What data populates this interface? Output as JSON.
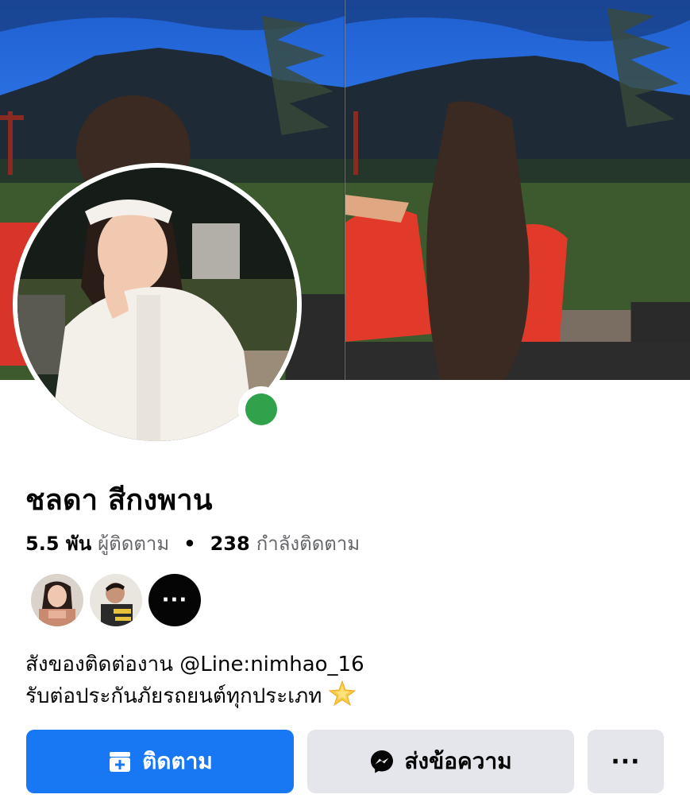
{
  "profile": {
    "name": "ชลดา สีกงพาน",
    "online": true
  },
  "stats": {
    "followers_count": "5.5 พัน",
    "followers_label": "ผู้ติดตาม",
    "separator": "•",
    "following_count": "238",
    "following_label": "กำลังติดตาม"
  },
  "mutual_friends": {
    "more_label": "···"
  },
  "bio": {
    "line1": "สังของติดต่องาน @Line:nimhao_16",
    "line2": "รับต่อประกันภัยรถยนต์ทุกประเภท",
    "emoji": "sparkle-star-icon"
  },
  "actions": {
    "follow_label": "ติดตาม",
    "message_label": "ส่งข้อความ",
    "more_label": "···"
  },
  "colors": {
    "primary": "#1877f2",
    "secondary_button": "#e4e6eb",
    "online": "#31a24c",
    "muted_text": "#65676b"
  }
}
